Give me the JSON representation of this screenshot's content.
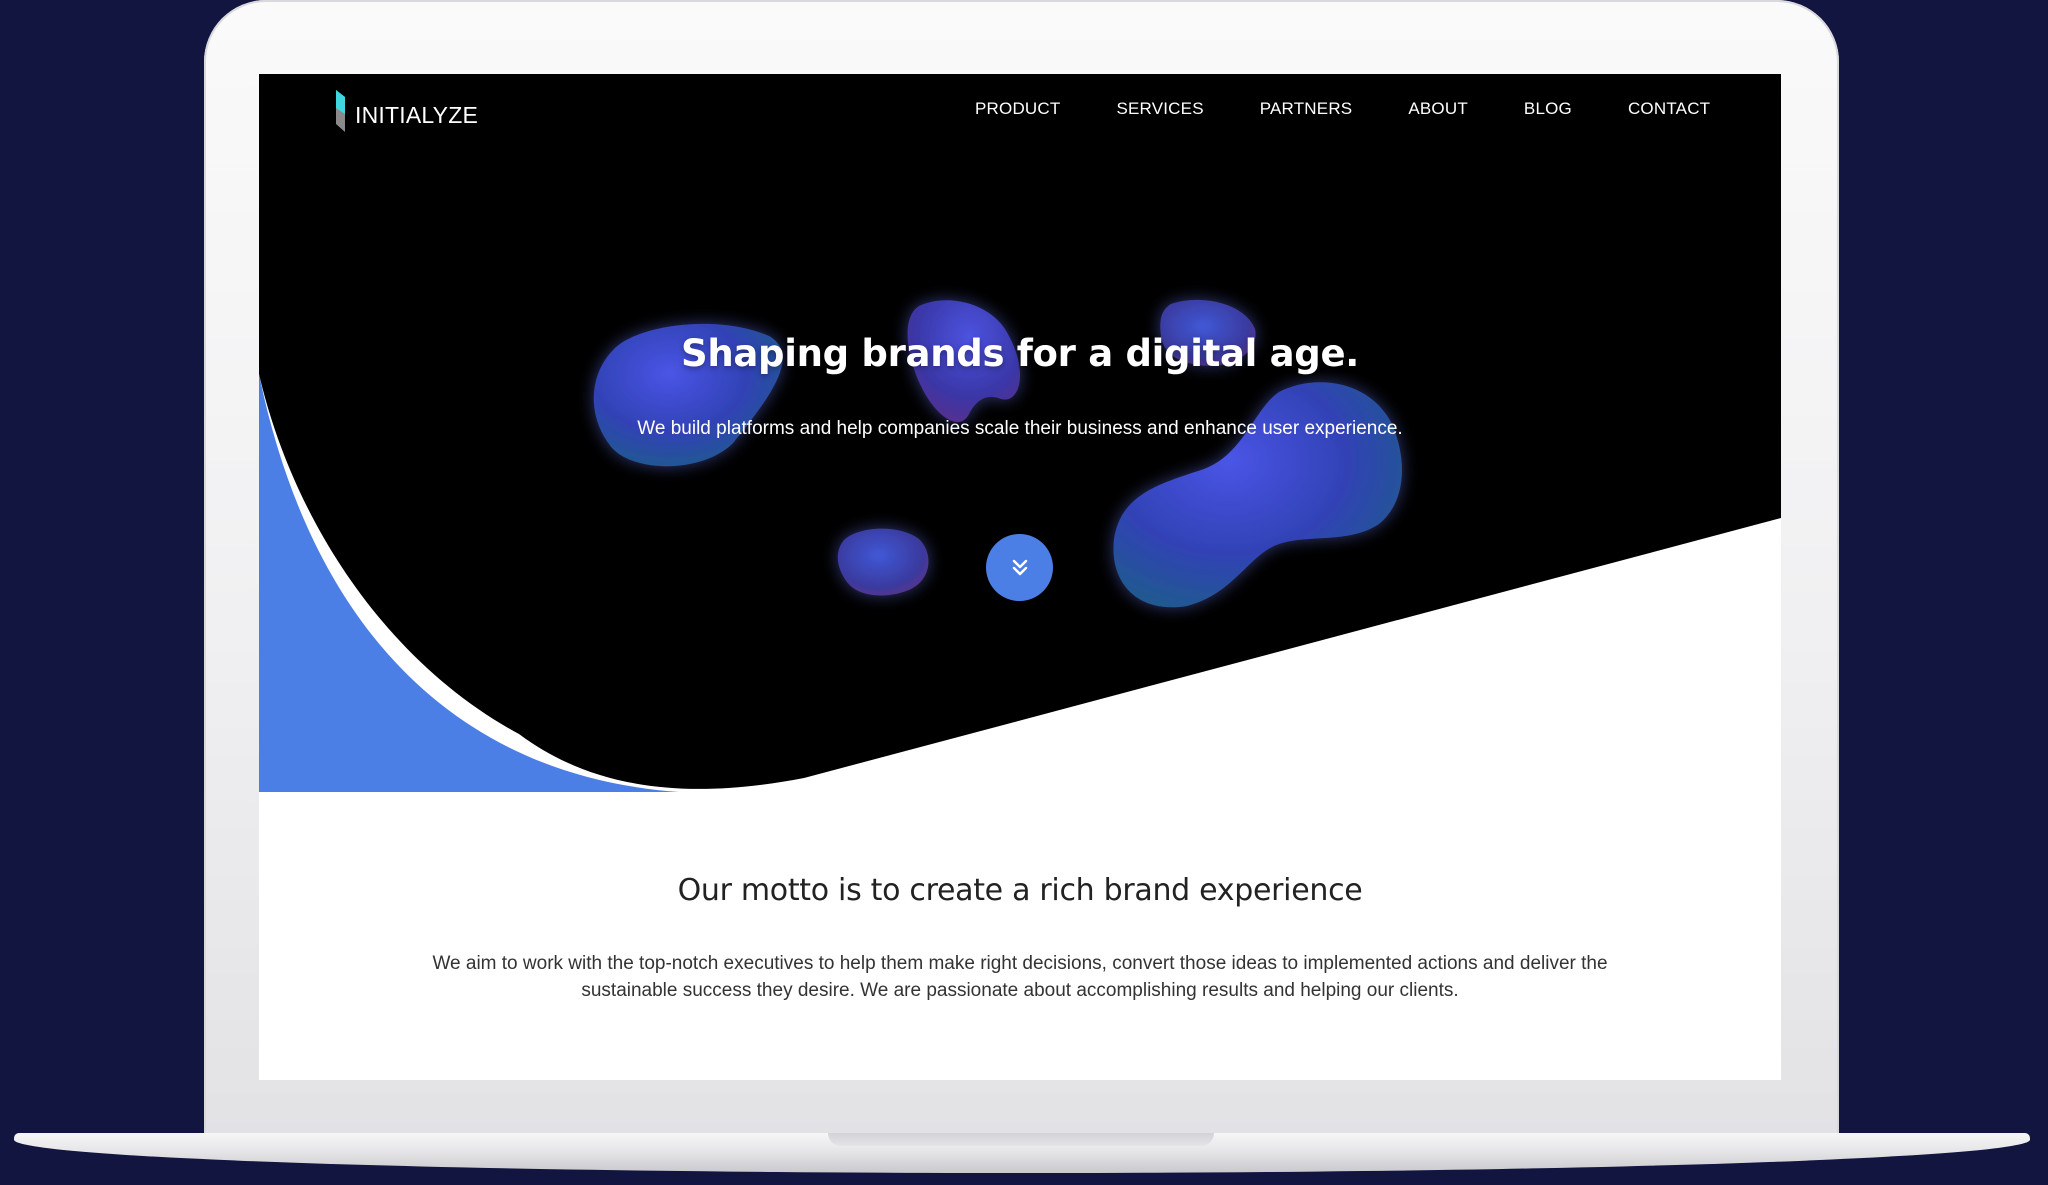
{
  "brand": {
    "name": "INITIALYZE"
  },
  "nav": {
    "items": [
      {
        "label": "PRODUCT"
      },
      {
        "label": "SERVICES"
      },
      {
        "label": "PARTNERS"
      },
      {
        "label": "ABOUT"
      },
      {
        "label": "BLOG"
      },
      {
        "label": "CONTACT"
      }
    ]
  },
  "hero": {
    "title": "Shaping brands for a digital age.",
    "subtitle": "We build platforms and help companies scale their business and enhance user experience.",
    "scroll_icon": "chevron-double-down-icon"
  },
  "motto": {
    "title": "Our motto is to create a rich brand experience",
    "body": "We aim to work with the top-notch executives to help them make right decisions, convert those ideas to implemented actions and deliver the sustainable success they desire. We are passionate about accomplishing results and helping our clients."
  },
  "colors": {
    "page_background": "#12153f",
    "hero_background": "#000000",
    "accent_blue": "#4c7fe6",
    "blob_blue": "#3b4fd0",
    "blob_purple": "#6a2e8e",
    "text_dark": "#222222"
  }
}
